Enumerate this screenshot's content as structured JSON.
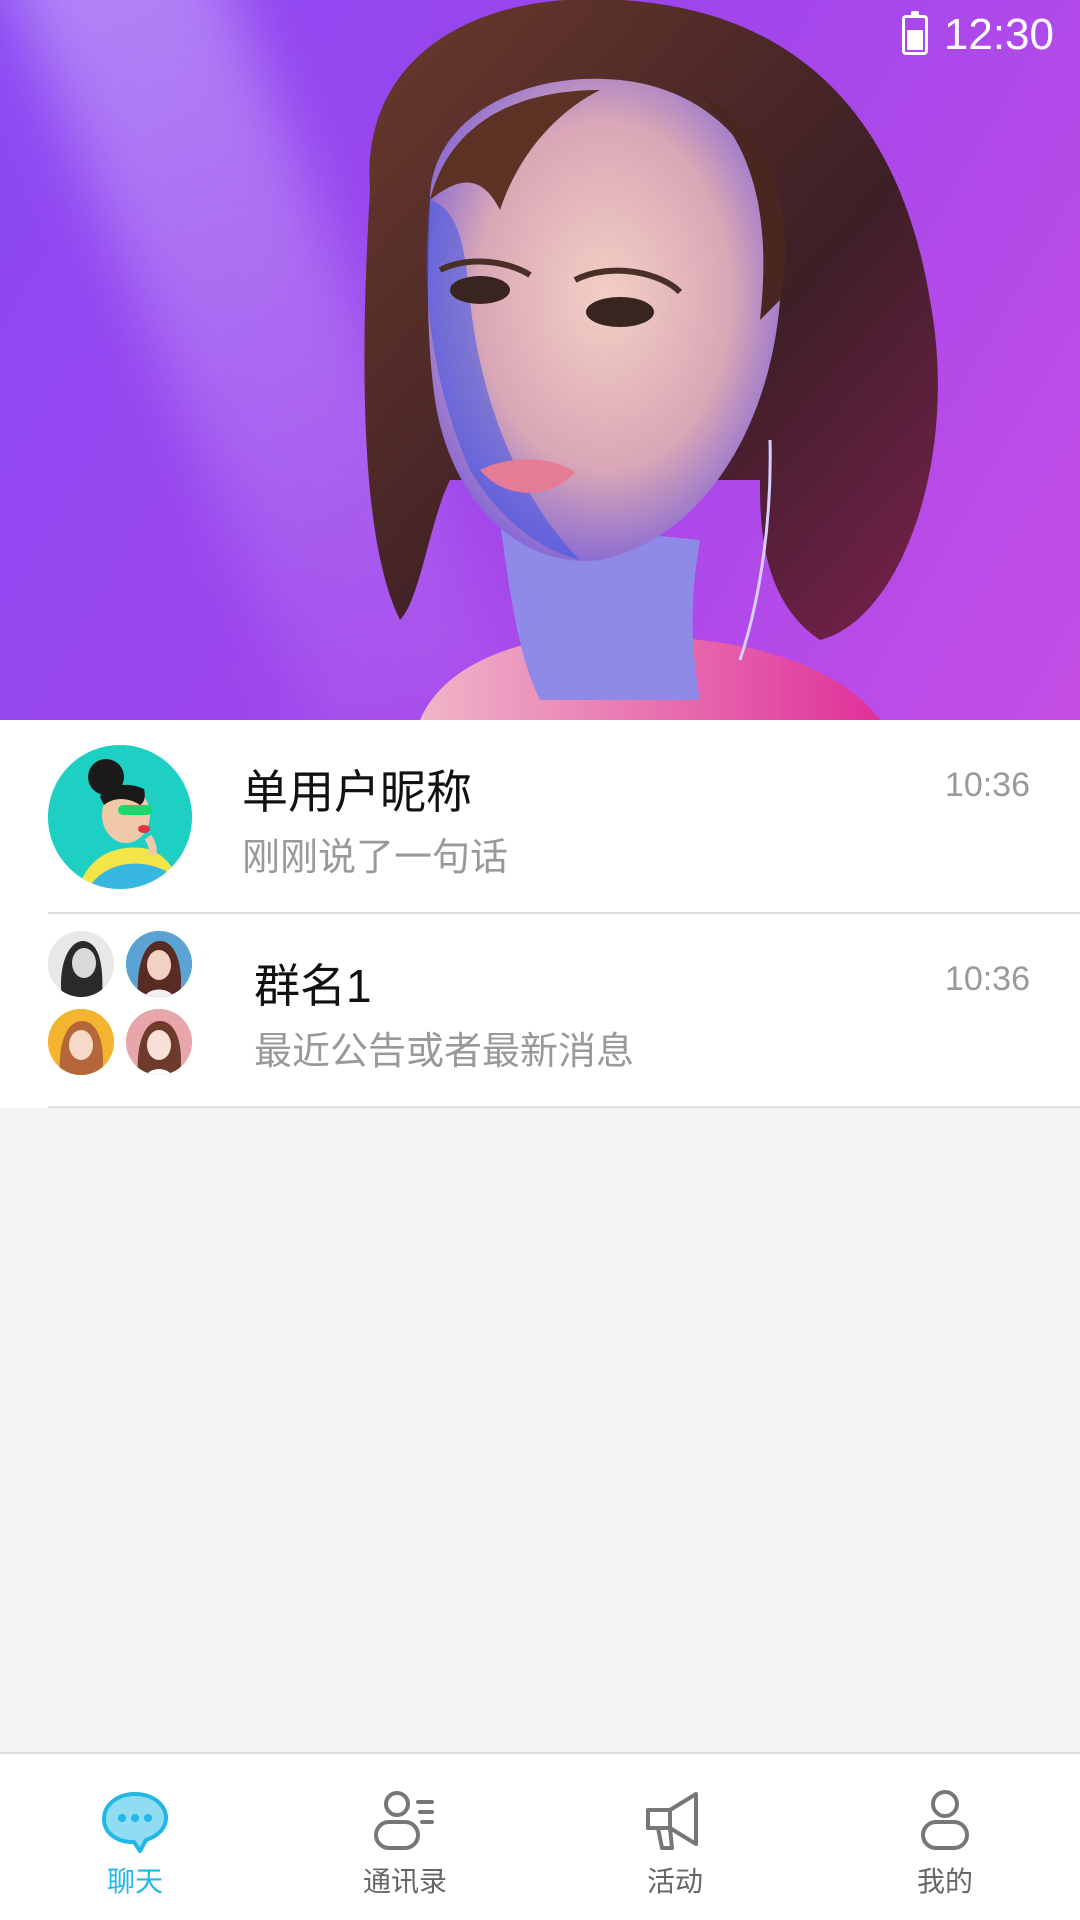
{
  "status_bar": {
    "time": "12:30",
    "battery_icon": "battery-icon"
  },
  "hero": {
    "image": "portrait-photo",
    "accent_color": "#9a47ef"
  },
  "chats": [
    {
      "name": "单用户昵称",
      "preview": "刚刚说了一句话",
      "time": "10:36",
      "avatar": "single-avatar"
    },
    {
      "name": "群名1",
      "preview": "最近公告或者最新消息",
      "time": "10:36",
      "avatar": "group-avatar"
    }
  ],
  "nav": {
    "active_color": "#21b7e6",
    "items": [
      {
        "label": "聊天",
        "icon": "chat-bubble-icon"
      },
      {
        "label": "通讯录",
        "icon": "contacts-icon"
      },
      {
        "label": "活动",
        "icon": "megaphone-icon"
      },
      {
        "label": "我的",
        "icon": "person-icon"
      }
    ]
  }
}
